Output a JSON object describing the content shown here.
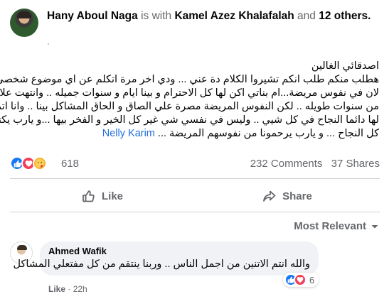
{
  "post": {
    "author": "Hany Aboul Naga",
    "with_text": "is with",
    "tagged": "Kamel Azez Khalafalah",
    "and_text": "and",
    "others": "12 others.",
    "audience": "·",
    "lines": [
      "اصدقائي الغالين",
      "هطلب منكم طلب انكم تشيروا الكلام دة عني ... ودي اخر مرة اتكلم عن اي موضوع شخصي ...",
      "لان في نفوس مريضة...ام بناتي اكن لها كل الاحترام و بينا ايام و سنوات جميله .. وانتهت علاقتنا",
      "من سنوات طويله .. لكن النفوس المريضة مصرة علي الصاق و الحاق المشاكل بينا .. وانا اتمني",
      "لها دائما النجاح في كل شيي .. وليس في نفسي شي غير كل الخير و الفخر بيها ...و يارب يكتبلها"
    ],
    "last_line": "كل النجاح ... و يارب يرحمونا من نفوسهم المريضة ...",
    "mention": "Nelly Karim"
  },
  "reactions": {
    "count": "618",
    "comments": "232 Comments",
    "shares": "37 Shares"
  },
  "actions": {
    "like": "Like",
    "share": "Share"
  },
  "sort": {
    "label": "Most Relevant"
  },
  "comment": {
    "author": "Ahmed Wafik",
    "text": "والله انتم الاتنين من اجمل الناس .. وربنا ينتقم من كل مفتعلي المشاكل",
    "reaction_count": "6",
    "like_label": "Like",
    "time": "· 22h"
  },
  "colors": {
    "facebook_blue": "#1877f2",
    "love": "#f33e58",
    "care": "#f7b125",
    "muted": "#65676b",
    "link": "#216fdb"
  }
}
